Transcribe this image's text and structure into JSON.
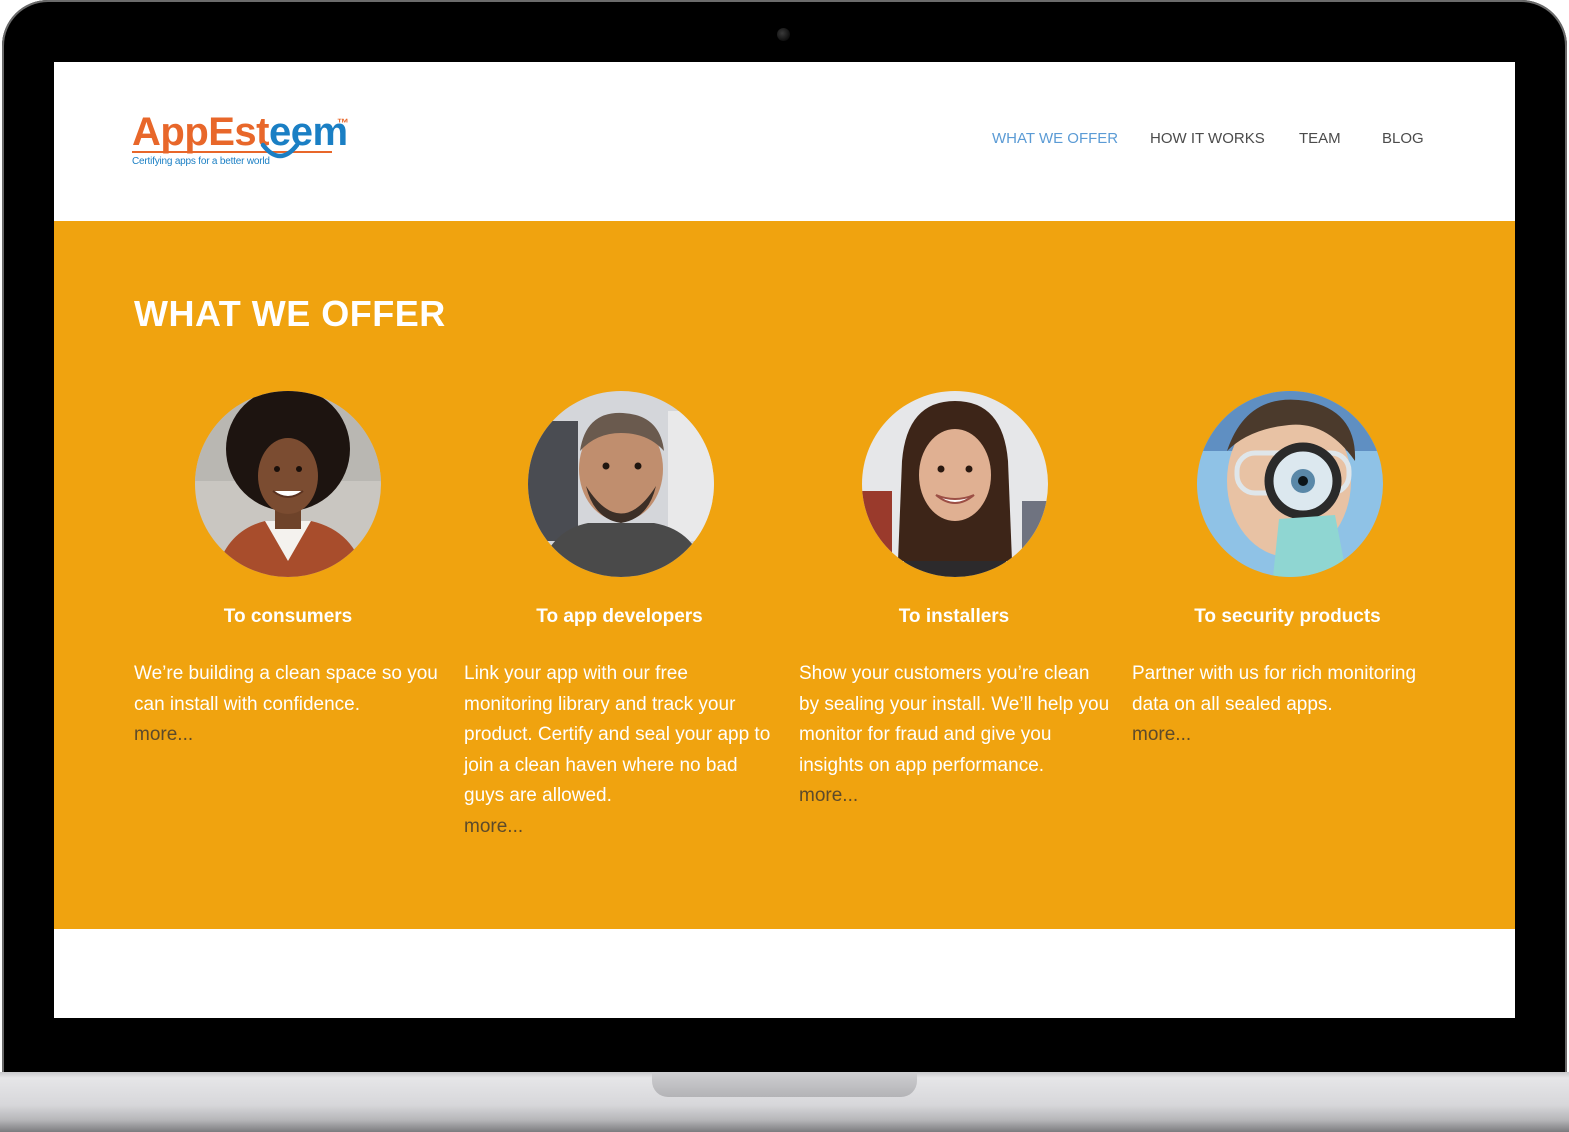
{
  "logo": {
    "word_part1": "AppEst",
    "word_part2": "eem",
    "trademark": "™",
    "tagline": "Certifying apps for a better world",
    "colors": {
      "orange": "#e8672a",
      "blue": "#1a7fc4"
    }
  },
  "nav": {
    "items": [
      {
        "label": "WHAT WE OFFER",
        "active": true
      },
      {
        "label": "HOW IT WORKS",
        "active": false
      },
      {
        "label": "TEAM",
        "active": false
      },
      {
        "label": "BLOG",
        "active": false
      }
    ]
  },
  "offer": {
    "title": "WHAT WE OFFER",
    "background_color": "#f0a30f",
    "columns": [
      {
        "title": "To consumers",
        "text": "We’re building a clean space so you can install with confidence.",
        "more": "more...",
        "photo": "smiling-woman-curly-hair-photo"
      },
      {
        "title": "To app developers",
        "text": "Link your app with our free monitoring library and track your product. Certify and seal your app to join a clean haven where no bad guys are allowed.",
        "more": "more...",
        "photo": "bearded-man-photo"
      },
      {
        "title": "To installers",
        "text": "Show your customers you’re clean by sealing your install. We’ll help you monitor for fraud and give you insights on app performance.",
        "more": "more...",
        "photo": "smiling-woman-brown-hair-photo"
      },
      {
        "title": "To security products",
        "text": "Partner with us for rich monitoring data on all sealed apps.",
        "more": "more...",
        "photo": "man-with-magnifying-glass-photo"
      }
    ]
  }
}
